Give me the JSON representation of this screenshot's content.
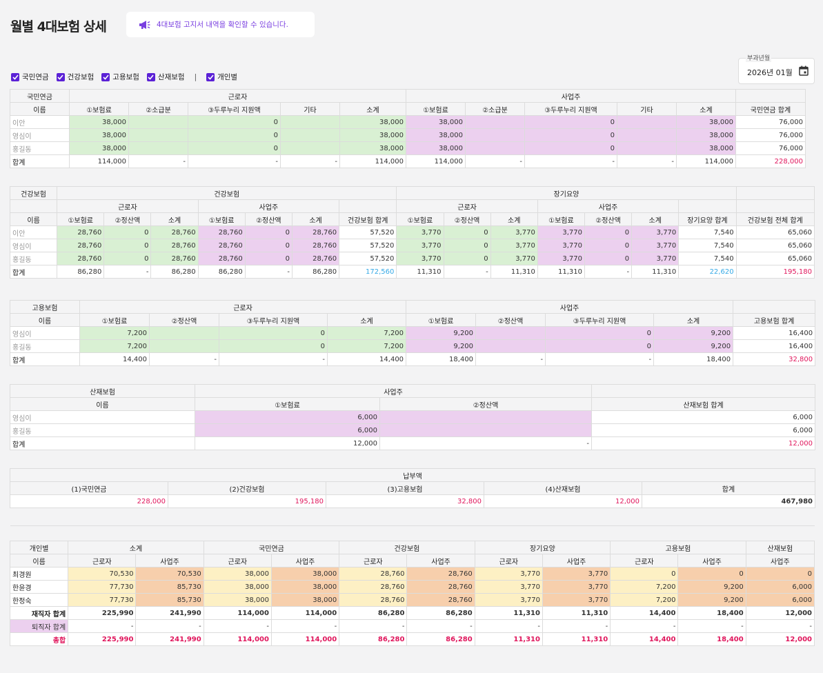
{
  "header": {
    "title": "월별 4대보험 상세",
    "notice": "4대보험 고지서 내역을 확인할 수 있습니다."
  },
  "filters": {
    "items": [
      "국민연금",
      "건강보험",
      "고용보험",
      "산재보험"
    ],
    "separator": "|",
    "person": "개인별"
  },
  "period": {
    "label": "부과년월",
    "value": "2026년 01월"
  },
  "pension": {
    "h": {
      "section": "국민연금",
      "worker": "근로자",
      "employer": "사업주",
      "name": "이름",
      "c1": "①보험료",
      "c2": "②소급분",
      "c3": "③두루누리 지원액",
      "c4": "기타",
      "sub": "소계",
      "total": "국민연금 합계"
    },
    "rows": [
      {
        "name": "이안",
        "v": [
          "38,000",
          "",
          "0",
          "",
          "38,000",
          "38,000",
          "",
          "0",
          "",
          "38,000",
          "76,000"
        ]
      },
      {
        "name": "영심이",
        "v": [
          "38,000",
          "",
          "0",
          "",
          "38,000",
          "38,000",
          "",
          "0",
          "",
          "38,000",
          "76,000"
        ]
      },
      {
        "name": "홍길동",
        "v": [
          "38,000",
          "",
          "0",
          "",
          "38,000",
          "38,000",
          "",
          "0",
          "",
          "38,000",
          "76,000"
        ]
      }
    ],
    "sum": {
      "name": "합계",
      "v": [
        "114,000",
        "-",
        "-",
        "-",
        "114,000",
        "114,000",
        "-",
        "-",
        "-",
        "114,000",
        "228,000"
      ]
    }
  },
  "health": {
    "h": {
      "section": "건강보험",
      "health": "건강보험",
      "ltc": "장기요양",
      "worker": "근로자",
      "employer": "사업주",
      "name": "이름",
      "c1": "①보험료",
      "c2": "②정산액",
      "sub": "소계",
      "htotal": "건강보험 합계",
      "ltotal": "장기요양 합계",
      "all": "건강보험 전체 합계"
    },
    "rows": [
      {
        "name": "이안",
        "v": [
          "28,760",
          "0",
          "28,760",
          "28,760",
          "0",
          "28,760",
          "57,520",
          "3,770",
          "0",
          "3,770",
          "3,770",
          "0",
          "3,770",
          "7,540",
          "65,060"
        ]
      },
      {
        "name": "영심이",
        "v": [
          "28,760",
          "0",
          "28,760",
          "28,760",
          "0",
          "28,760",
          "57,520",
          "3,770",
          "0",
          "3,770",
          "3,770",
          "0",
          "3,770",
          "7,540",
          "65,060"
        ]
      },
      {
        "name": "홍길동",
        "v": [
          "28,760",
          "0",
          "28,760",
          "28,760",
          "0",
          "28,760",
          "57,520",
          "3,770",
          "0",
          "3,770",
          "3,770",
          "0",
          "3,770",
          "7,540",
          "65,060"
        ]
      }
    ],
    "sum": {
      "name": "합계",
      "v": [
        "86,280",
        "-",
        "86,280",
        "86,280",
        "-",
        "86,280",
        "172,560",
        "11,310",
        "-",
        "11,310",
        "11,310",
        "-",
        "11,310",
        "22,620",
        "195,180"
      ]
    }
  },
  "employ": {
    "h": {
      "section": "고용보험",
      "worker": "근로자",
      "employer": "사업주",
      "name": "이름",
      "c1": "①보험료",
      "c2": "②정산액",
      "c3": "③두루누리 지원액",
      "sub": "소계",
      "total": "고용보험 합계"
    },
    "rows": [
      {
        "name": "영심이",
        "v": [
          "7,200",
          "",
          "0",
          "7,200",
          "9,200",
          "",
          "0",
          "9,200",
          "16,400"
        ]
      },
      {
        "name": "홍길동",
        "v": [
          "7,200",
          "",
          "0",
          "7,200",
          "9,200",
          "",
          "0",
          "9,200",
          "16,400"
        ]
      }
    ],
    "sum": {
      "name": "합계",
      "v": [
        "14,400",
        "-",
        "-",
        "14,400",
        "18,400",
        "-",
        "-",
        "18,400",
        "32,800"
      ]
    }
  },
  "accident": {
    "h": {
      "section": "산재보험",
      "employer": "사업주",
      "name": "이름",
      "c1": "①보험료",
      "c2": "②정산액",
      "total": "산재보험 합계"
    },
    "rows": [
      {
        "name": "영심이",
        "v": [
          "6,000",
          "",
          "6,000"
        ]
      },
      {
        "name": "홍길동",
        "v": [
          "6,000",
          "",
          "6,000"
        ]
      }
    ],
    "sum": {
      "name": "합계",
      "v": [
        "12,000",
        "-",
        "12,000"
      ]
    }
  },
  "payment": {
    "title": "납부액",
    "cols": [
      "(1)국민연금",
      "(2)건강보험",
      "(3)고용보험",
      "(4)산재보험",
      "합계"
    ],
    "values": [
      "228,000",
      "195,180",
      "32,800",
      "12,000",
      "467,980"
    ]
  },
  "person": {
    "h": {
      "section": "개인별",
      "name": "이름",
      "groups": [
        "소계",
        "국민연금",
        "건강보험",
        "장기요양",
        "고용보험",
        "산재보험"
      ],
      "worker": "근로자",
      "employer": "사업주"
    },
    "rows": [
      {
        "name": "최경원",
        "v": [
          "70,530",
          "70,530",
          "38,000",
          "38,000",
          "28,760",
          "28,760",
          "3,770",
          "3,770",
          "0",
          "0",
          "0"
        ]
      },
      {
        "name": "한윤경",
        "v": [
          "77,730",
          "85,730",
          "38,000",
          "38,000",
          "28,760",
          "28,760",
          "3,770",
          "3,770",
          "7,200",
          "9,200",
          "6,000"
        ]
      },
      {
        "name": "한정숙",
        "v": [
          "77,730",
          "85,730",
          "38,000",
          "38,000",
          "28,760",
          "28,760",
          "3,770",
          "3,770",
          "7,200",
          "9,200",
          "6,000"
        ]
      }
    ],
    "employed": {
      "name": "재직자 합계",
      "v": [
        "225,990",
        "241,990",
        "114,000",
        "114,000",
        "86,280",
        "86,280",
        "11,310",
        "11,310",
        "14,400",
        "18,400",
        "12,000"
      ]
    },
    "retired": {
      "name": "퇴직자 합계",
      "v": [
        "-",
        "-",
        "-",
        "-",
        "-",
        "-",
        "-",
        "-",
        "-",
        "-",
        "-"
      ]
    },
    "grand": {
      "name": "총합",
      "v": [
        "225,990",
        "241,990",
        "114,000",
        "114,000",
        "86,280",
        "86,280",
        "11,310",
        "11,310",
        "14,400",
        "18,400",
        "12,000"
      ]
    }
  }
}
